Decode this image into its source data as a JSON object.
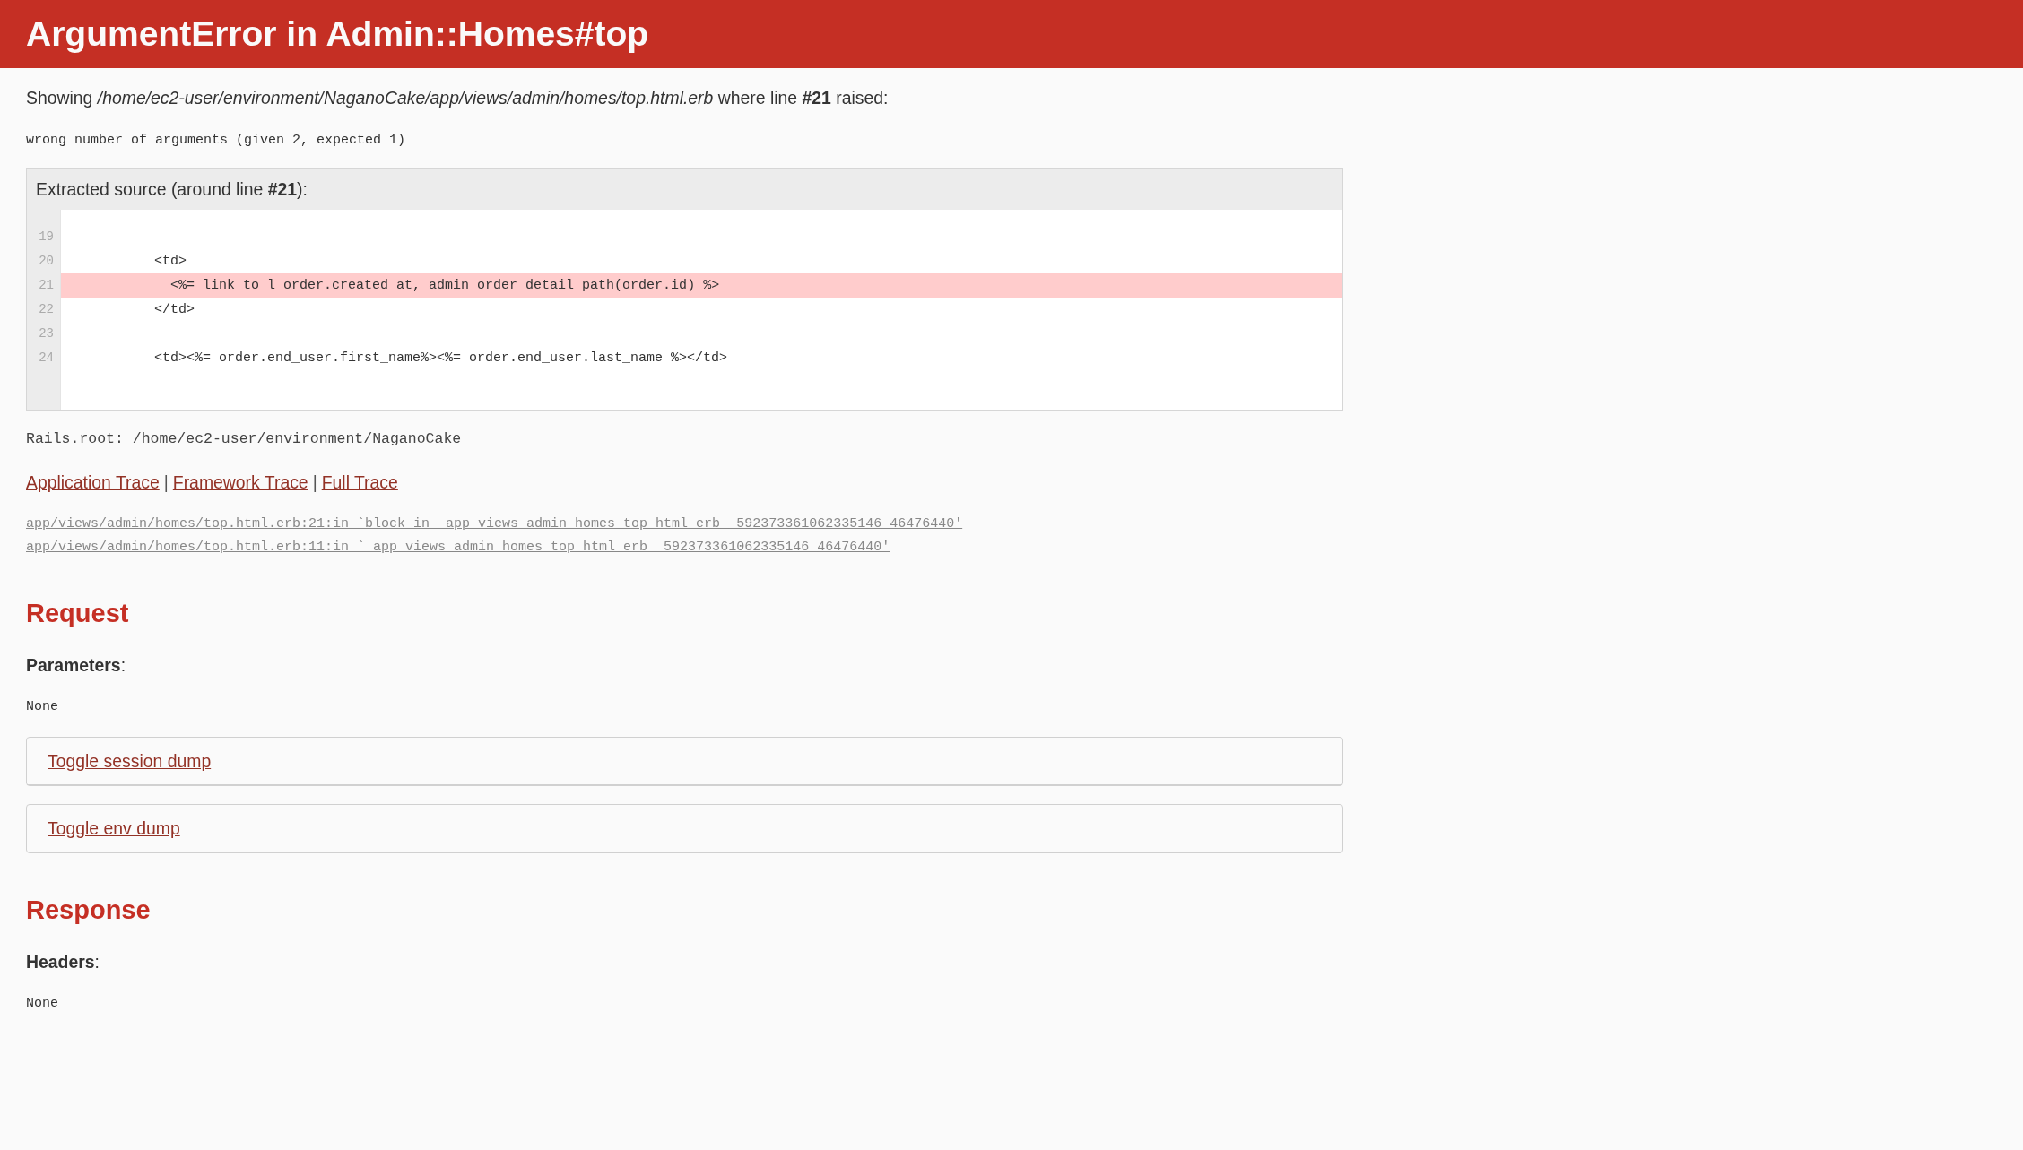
{
  "header": {
    "title": "ArgumentError in Admin::Homes#top"
  },
  "location": "Showing */home/ec2-user/environment/NaganoCake/app/views/admin/homes/top.html.erb* where line **#21** raised:",
  "error_message": "wrong number of arguments (given 2, expected 1)",
  "source": {
    "title": "Extracted source (around line **#21**):",
    "lines": [
      {
        "number": "19",
        "highlighted": false
      },
      {
        "number": "20",
        "code": "          <td>",
        "highlighted": false
      },
      {
        "number": "21",
        "code": "            <%= link_to l order.created_at, admin_order_detail_path(order.id) %>",
        "highlighted": true
      },
      {
        "number": "22",
        "code": "          </td>",
        "highlighted": false
      },
      {
        "number": "23",
        "highlighted": false
      },
      {
        "number": "24",
        "code": "          <td><%= order.end_user.first_name%><%= order.end_user.last_name %></td>",
        "highlighted": false
      }
    ]
  },
  "rails_root": "Rails.root: /home/ec2-user/environment/NaganoCake",
  "trace_tabs": [
    {
      "kind": "link",
      "label": "Application Trace"
    },
    {
      "kind": "separator",
      "label": "|"
    },
    {
      "kind": "link",
      "label": "Framework Trace"
    },
    {
      "kind": "separator",
      "label": "|"
    },
    {
      "kind": "link",
      "label": "Full Trace"
    }
  ],
  "trace": [
    "app/views/admin/homes/top.html.erb:21:in `block in _app_views_admin_homes_top_html_erb__592373361062335146_46476440'",
    "app/views/admin/homes/top.html.erb:11:in `_app_views_admin_homes_top_html_erb__592373361062335146_46476440'"
  ],
  "request": {
    "heading": "Request",
    "parameters_label": "**Parameters**:",
    "parameters": "None",
    "dumps": [
      "Toggle session dump",
      "Toggle env dump"
    ]
  },
  "response": {
    "heading": "Response",
    "headers_label": "**Headers**:",
    "headers": "None"
  }
}
